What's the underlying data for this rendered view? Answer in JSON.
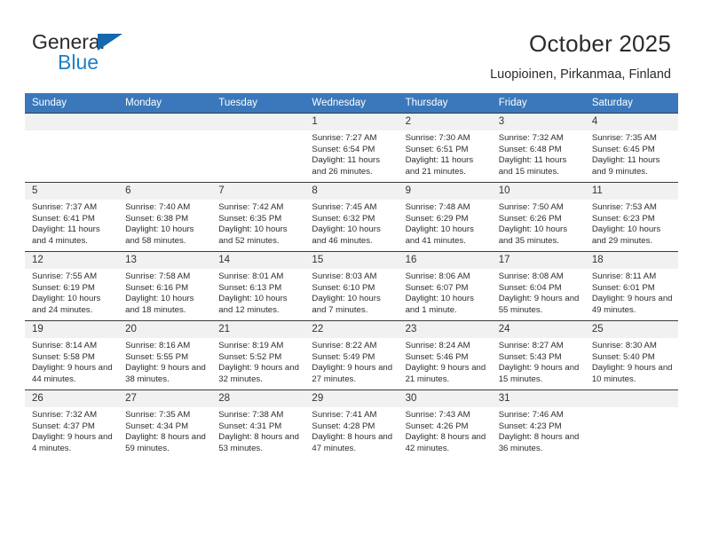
{
  "brand": {
    "name_top": "General",
    "name_bottom": "Blue",
    "accent_color": "#1f7fc4",
    "triangle_color": "#1568b0"
  },
  "header": {
    "title": "October 2025",
    "subtitle": "Luopioinen, Pirkanmaa, Finland",
    "header_bg_color": "#3a78bb",
    "daynum_bg_color": "#f1f1f1"
  },
  "weekdays": [
    "Sunday",
    "Monday",
    "Tuesday",
    "Wednesday",
    "Thursday",
    "Friday",
    "Saturday"
  ],
  "labels": {
    "sunrise_prefix": "Sunrise:",
    "sunset_prefix": "Sunset:",
    "daylight_prefix": "Daylight:"
  },
  "weeks": [
    [
      {
        "day": "",
        "sunrise": "",
        "sunset": "",
        "daylight": ""
      },
      {
        "day": "",
        "sunrise": "",
        "sunset": "",
        "daylight": ""
      },
      {
        "day": "",
        "sunrise": "",
        "sunset": "",
        "daylight": ""
      },
      {
        "day": "1",
        "sunrise": "Sunrise: 7:27 AM",
        "sunset": "Sunset: 6:54 PM",
        "daylight": "Daylight: 11 hours and 26 minutes."
      },
      {
        "day": "2",
        "sunrise": "Sunrise: 7:30 AM",
        "sunset": "Sunset: 6:51 PM",
        "daylight": "Daylight: 11 hours and 21 minutes."
      },
      {
        "day": "3",
        "sunrise": "Sunrise: 7:32 AM",
        "sunset": "Sunset: 6:48 PM",
        "daylight": "Daylight: 11 hours and 15 minutes."
      },
      {
        "day": "4",
        "sunrise": "Sunrise: 7:35 AM",
        "sunset": "Sunset: 6:45 PM",
        "daylight": "Daylight: 11 hours and 9 minutes."
      }
    ],
    [
      {
        "day": "5",
        "sunrise": "Sunrise: 7:37 AM",
        "sunset": "Sunset: 6:41 PM",
        "daylight": "Daylight: 11 hours and 4 minutes."
      },
      {
        "day": "6",
        "sunrise": "Sunrise: 7:40 AM",
        "sunset": "Sunset: 6:38 PM",
        "daylight": "Daylight: 10 hours and 58 minutes."
      },
      {
        "day": "7",
        "sunrise": "Sunrise: 7:42 AM",
        "sunset": "Sunset: 6:35 PM",
        "daylight": "Daylight: 10 hours and 52 minutes."
      },
      {
        "day": "8",
        "sunrise": "Sunrise: 7:45 AM",
        "sunset": "Sunset: 6:32 PM",
        "daylight": "Daylight: 10 hours and 46 minutes."
      },
      {
        "day": "9",
        "sunrise": "Sunrise: 7:48 AM",
        "sunset": "Sunset: 6:29 PM",
        "daylight": "Daylight: 10 hours and 41 minutes."
      },
      {
        "day": "10",
        "sunrise": "Sunrise: 7:50 AM",
        "sunset": "Sunset: 6:26 PM",
        "daylight": "Daylight: 10 hours and 35 minutes."
      },
      {
        "day": "11",
        "sunrise": "Sunrise: 7:53 AM",
        "sunset": "Sunset: 6:23 PM",
        "daylight": "Daylight: 10 hours and 29 minutes."
      }
    ],
    [
      {
        "day": "12",
        "sunrise": "Sunrise: 7:55 AM",
        "sunset": "Sunset: 6:19 PM",
        "daylight": "Daylight: 10 hours and 24 minutes."
      },
      {
        "day": "13",
        "sunrise": "Sunrise: 7:58 AM",
        "sunset": "Sunset: 6:16 PM",
        "daylight": "Daylight: 10 hours and 18 minutes."
      },
      {
        "day": "14",
        "sunrise": "Sunrise: 8:01 AM",
        "sunset": "Sunset: 6:13 PM",
        "daylight": "Daylight: 10 hours and 12 minutes."
      },
      {
        "day": "15",
        "sunrise": "Sunrise: 8:03 AM",
        "sunset": "Sunset: 6:10 PM",
        "daylight": "Daylight: 10 hours and 7 minutes."
      },
      {
        "day": "16",
        "sunrise": "Sunrise: 8:06 AM",
        "sunset": "Sunset: 6:07 PM",
        "daylight": "Daylight: 10 hours and 1 minute."
      },
      {
        "day": "17",
        "sunrise": "Sunrise: 8:08 AM",
        "sunset": "Sunset: 6:04 PM",
        "daylight": "Daylight: 9 hours and 55 minutes."
      },
      {
        "day": "18",
        "sunrise": "Sunrise: 8:11 AM",
        "sunset": "Sunset: 6:01 PM",
        "daylight": "Daylight: 9 hours and 49 minutes."
      }
    ],
    [
      {
        "day": "19",
        "sunrise": "Sunrise: 8:14 AM",
        "sunset": "Sunset: 5:58 PM",
        "daylight": "Daylight: 9 hours and 44 minutes."
      },
      {
        "day": "20",
        "sunrise": "Sunrise: 8:16 AM",
        "sunset": "Sunset: 5:55 PM",
        "daylight": "Daylight: 9 hours and 38 minutes."
      },
      {
        "day": "21",
        "sunrise": "Sunrise: 8:19 AM",
        "sunset": "Sunset: 5:52 PM",
        "daylight": "Daylight: 9 hours and 32 minutes."
      },
      {
        "day": "22",
        "sunrise": "Sunrise: 8:22 AM",
        "sunset": "Sunset: 5:49 PM",
        "daylight": "Daylight: 9 hours and 27 minutes."
      },
      {
        "day": "23",
        "sunrise": "Sunrise: 8:24 AM",
        "sunset": "Sunset: 5:46 PM",
        "daylight": "Daylight: 9 hours and 21 minutes."
      },
      {
        "day": "24",
        "sunrise": "Sunrise: 8:27 AM",
        "sunset": "Sunset: 5:43 PM",
        "daylight": "Daylight: 9 hours and 15 minutes."
      },
      {
        "day": "25",
        "sunrise": "Sunrise: 8:30 AM",
        "sunset": "Sunset: 5:40 PM",
        "daylight": "Daylight: 9 hours and 10 minutes."
      }
    ],
    [
      {
        "day": "26",
        "sunrise": "Sunrise: 7:32 AM",
        "sunset": "Sunset: 4:37 PM",
        "daylight": "Daylight: 9 hours and 4 minutes."
      },
      {
        "day": "27",
        "sunrise": "Sunrise: 7:35 AM",
        "sunset": "Sunset: 4:34 PM",
        "daylight": "Daylight: 8 hours and 59 minutes."
      },
      {
        "day": "28",
        "sunrise": "Sunrise: 7:38 AM",
        "sunset": "Sunset: 4:31 PM",
        "daylight": "Daylight: 8 hours and 53 minutes."
      },
      {
        "day": "29",
        "sunrise": "Sunrise: 7:41 AM",
        "sunset": "Sunset: 4:28 PM",
        "daylight": "Daylight: 8 hours and 47 minutes."
      },
      {
        "day": "30",
        "sunrise": "Sunrise: 7:43 AM",
        "sunset": "Sunset: 4:26 PM",
        "daylight": "Daylight: 8 hours and 42 minutes."
      },
      {
        "day": "31",
        "sunrise": "Sunrise: 7:46 AM",
        "sunset": "Sunset: 4:23 PM",
        "daylight": "Daylight: 8 hours and 36 minutes."
      },
      {
        "day": "",
        "sunrise": "",
        "sunset": "",
        "daylight": ""
      }
    ]
  ]
}
